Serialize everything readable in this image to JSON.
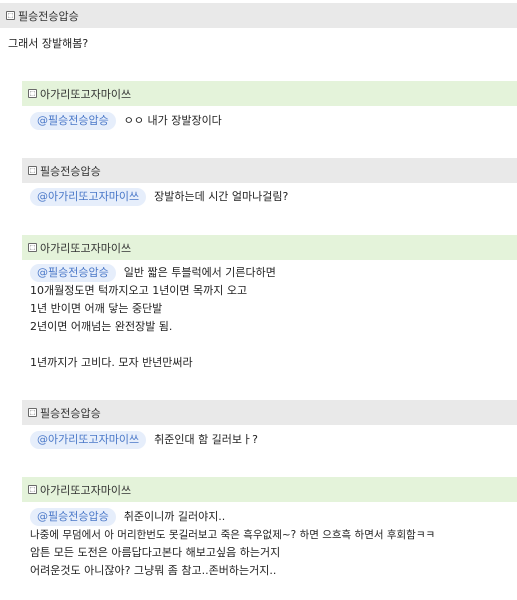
{
  "root": {
    "author": "필승전승압승",
    "text": "그래서 장발해봄?"
  },
  "replies": [
    {
      "author": "아가리또고자마이쓰",
      "mention": "@필승전승압승",
      "lines": [
        "ㅇㅇ 내가 장발장이다"
      ]
    },
    {
      "author": "필승전승압승",
      "mention": "@아가리또고자마이쓰",
      "lines": [
        "장발하는데 시간 얼마나걸림?"
      ]
    },
    {
      "author": "아가리또고자마이쓰",
      "mention": "@필승전승압승",
      "lines": [
        "일반 짧은 투블럭에서 기른다하면",
        "10개월정도면 턱까지오고 1년이면 목까지 오고",
        "1년 반이면 어깨 닿는 중단발",
        "2년이면 어깨넘는 완전장발 됨.",
        "",
        "1년까지가 고비다. 모자 반년만써라"
      ]
    },
    {
      "author": "필승전승압승",
      "mention": "@아가리또고자마이쓰",
      "lines": [
        "취준인대 함 길러보ㅏ?"
      ]
    },
    {
      "author": "아가리또고자마이쓰",
      "mention": "@필승전승압승",
      "lines": [
        "취준이니까 길러야지..",
        "나중에 무덤에서 아 머리한번도 못길러보고 죽은 흑우없제~? 하면 으흐흑 하면서 후회함ㅋㅋ",
        "암튼 모든 도전은 아름답다고본다 해보고싶음 하는거지",
        "어려운것도 아니잖아? 그냥뭐 좀 참고..존버하는거지.."
      ]
    }
  ],
  "icon": {
    "name": "user-badge-icon",
    "glyph": "ᅵ"
  },
  "colors": {
    "gray_header": "#e9e9e9",
    "green_header": "#e4f3da",
    "mention_bg": "#e6eefb",
    "mention_text": "#4a78c8"
  }
}
